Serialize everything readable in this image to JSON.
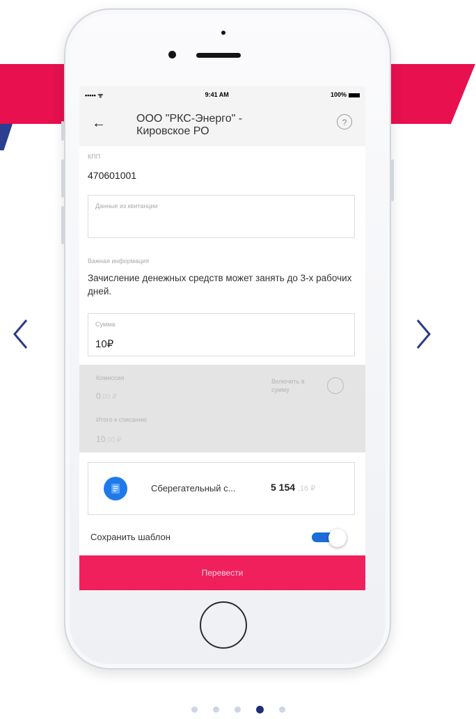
{
  "status_bar": {
    "signal": "••••• ᯤ",
    "time": "9:41 AM",
    "battery": "100%"
  },
  "header": {
    "back_glyph": "←",
    "title": "ООО \"РКС-Энерго\" - Кировское РО",
    "help_glyph": "?"
  },
  "form": {
    "kpp_label": "КПП",
    "kpp_value": "470601001",
    "receipt_placeholder": "Данные из квитанции",
    "info_label": "Важная информация",
    "info_text": "Зачисление денежных средств может занять до 3-х рабочих дней.",
    "sum_label": "Сумма",
    "sum_value": "10₽"
  },
  "commission": {
    "label": "Комиссия",
    "value_main": "0",
    "value_dim": ",00 ₽",
    "include_label": "Включить в сумму",
    "total_label": "Итого к списанию",
    "total_main": "10",
    "total_dim": ",00 ₽"
  },
  "account": {
    "name": "Сберегательный с...",
    "balance_main": "5 154",
    "balance_dim": ",16 ₽"
  },
  "save_template": {
    "label": "Сохранить шаблон",
    "enabled": true
  },
  "submit_label": "Перевести",
  "pager": {
    "total": 5,
    "active": 4
  },
  "colors": {
    "accent_pink": "#f0205d",
    "banner_red": "#e8104f",
    "nav_blue": "#2b3a84",
    "toggle_blue": "#1a6dd6",
    "account_blue": "#1f7ae8"
  },
  "icons": {
    "prev": "chevron-left-icon",
    "next": "chevron-right-icon",
    "back": "arrow-left-icon",
    "help": "question-icon",
    "account": "document-icon"
  }
}
